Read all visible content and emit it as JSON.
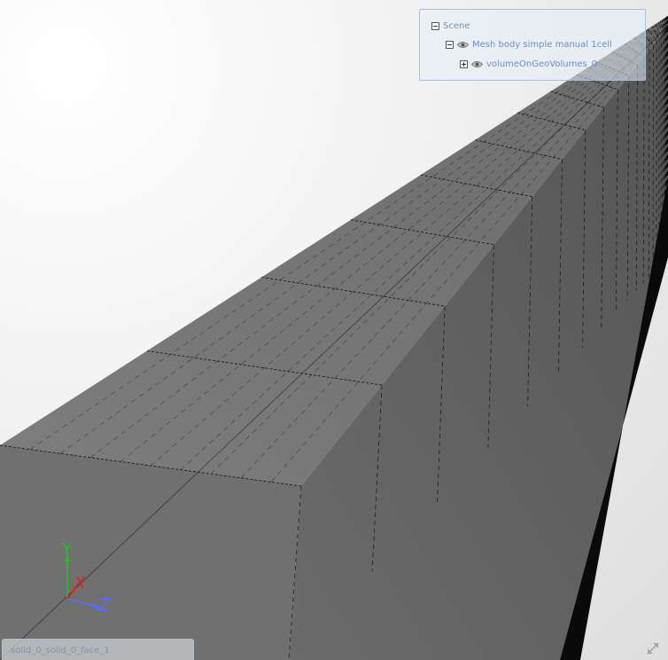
{
  "scene_tree": {
    "root": {
      "label": "Scene"
    },
    "mesh_body": {
      "label": "Mesh body simple manual 1cell"
    },
    "volume": {
      "label": "volumeOnGeoVolumes_0"
    }
  },
  "axes": {
    "x": "X",
    "y": "Y",
    "z": "Z"
  },
  "status_bar": {
    "selection": "solid_0_solid_0_face_1"
  },
  "icons": {
    "collapse": "minus-box-icon",
    "expand": "plus-box-icon",
    "visibility": "eye-icon",
    "fullscreen": "expand-arrows-icon"
  },
  "colors": {
    "top_face": "#7b7b7b",
    "side_face": "#6a6a6a",
    "axis_x": "#e0201a",
    "axis_y": "#25c125",
    "axis_z": "#5b6bff",
    "tree_text": "#6d8fc4"
  }
}
